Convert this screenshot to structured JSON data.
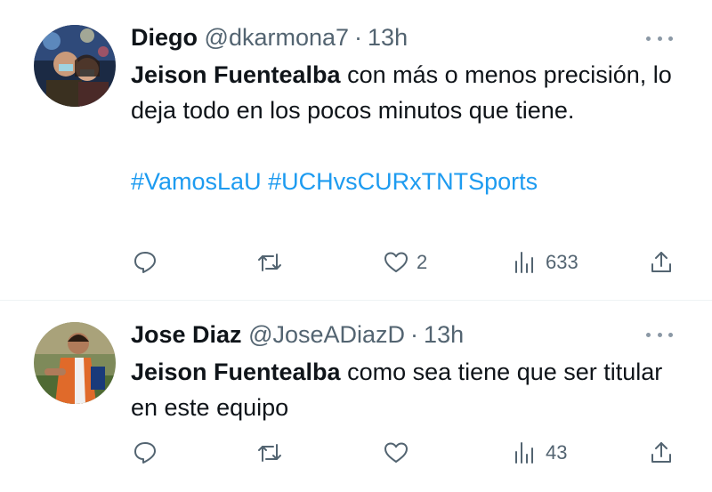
{
  "tweets": [
    {
      "author": {
        "name": "Diego",
        "handle": "@dkarmona7",
        "separator": "·",
        "time": "13h"
      },
      "text": {
        "mention": "Jeison Fuentealba",
        "body": " con más o menos precisión, lo deja todo en los pocos minutos que tiene.",
        "hashtags": [
          "#VamosLaU",
          "#UCHvsCURxTNTSports"
        ]
      },
      "metrics": {
        "replies": "",
        "retweets": "",
        "likes": "2",
        "views": "633"
      },
      "icons": {
        "more": "more-dots-icon",
        "reply": "reply-icon",
        "retweet": "retweet-icon",
        "like": "heart-icon",
        "views": "views-chart-icon",
        "share": "share-icon"
      }
    },
    {
      "author": {
        "name": "Jose Diaz",
        "handle": "@JoseADiazD",
        "separator": "·",
        "time": "13h"
      },
      "text": {
        "mention": "Jeison Fuentealba",
        "body": " como sea tiene que ser titular en este equipo"
      },
      "metrics": {
        "replies": "",
        "retweets": "",
        "likes": "",
        "views": "43"
      },
      "icons": {
        "more": "more-dots-icon",
        "reply": "reply-icon",
        "retweet": "retweet-icon",
        "like": "heart-icon",
        "views": "views-chart-icon",
        "share": "share-icon"
      }
    }
  ],
  "colors": {
    "link": "#1d9bf0",
    "muted": "#536471",
    "text": "#0f1419",
    "divider": "#eff3f4"
  }
}
